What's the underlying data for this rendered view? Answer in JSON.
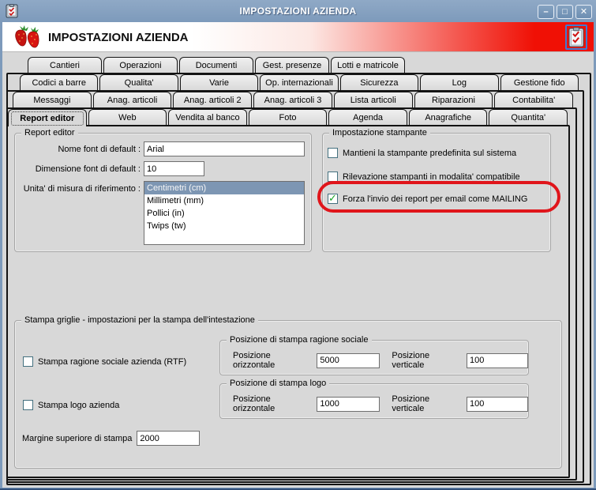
{
  "window": {
    "title": "IMPOSTAZIONI AZIENDA",
    "minimize_glyph": "–",
    "maximize_glyph": "□",
    "close_glyph": "✕"
  },
  "header": {
    "title": "IMPOSTAZIONI AZIENDA"
  },
  "glyphs": {
    "check": "✓"
  },
  "colors": {
    "titlebar_blue": "#7d9abb",
    "header_red": "#f01005",
    "selection_blue": "#7d96b3",
    "annotation_red": "#e0151b",
    "check_green": "#18a427"
  },
  "tabs": {
    "active_tab": "Report editor",
    "rows": [
      {
        "items": [
          "Cantieri",
          "Operazioni",
          "Documenti",
          "Gest. presenze",
          "Lotti e matricole"
        ]
      },
      {
        "items": [
          "Codici a barre",
          "Qualita'",
          "Varie",
          "Op. internazionali",
          "Sicurezza",
          "Log",
          "Gestione fido"
        ]
      },
      {
        "items": [
          "Messaggi",
          "Anag. articoli",
          "Anag. articoli 2",
          "Anag. articoli 3",
          "Lista articoli",
          "Riparazioni",
          "Contabilita'"
        ]
      },
      {
        "items": [
          "Report editor",
          "Web",
          "Vendita al banco",
          "Foto",
          "Agenda",
          "Anagrafiche",
          "Quantita'"
        ]
      }
    ]
  },
  "report_editor": {
    "title": "Report editor",
    "font_name_label": "Nome font di default :",
    "font_name_value": "Arial",
    "font_size_label": "Dimensione font di default :",
    "font_size_value": "10",
    "unit_label": "Unita' di misura di riferimento :",
    "unit_options": [
      "Centimetri (cm)",
      "Millimetri (mm)",
      "Pollici (in)",
      "Twips (tw)"
    ],
    "unit_selected": "Centimetri (cm)"
  },
  "printer": {
    "title": "Impostazione stampante",
    "cb_mantieni": "Mantieni la stampante predefinita sul sistema",
    "cb_rilevazione": "Rilevazione stampanti in modalita' compatibile",
    "cb_forza": "Forza l'invio dei report per email come MAILING",
    "cb_forza_checked": true
  },
  "grid": {
    "title": "Stampa griglie - impostazioni per la stampa dell'intestazione",
    "cb_ragione": "Stampa ragione sociale azienda (RTF)",
    "cb_logo": "Stampa logo azienda",
    "margine_label": "Margine superiore di stampa",
    "margine_value": "2000",
    "pos_ragione": {
      "title": "Posizione di stampa ragione sociale",
      "h_label": "Posizione orizzontale",
      "h_value": "5000",
      "v_label": "Posizione verticale",
      "v_value": "100"
    },
    "pos_logo": {
      "title": "Posizione di stampa logo",
      "h_label": "Posizione orizzontale",
      "h_value": "1000",
      "v_label": "Posizione verticale",
      "v_value": "100"
    }
  }
}
